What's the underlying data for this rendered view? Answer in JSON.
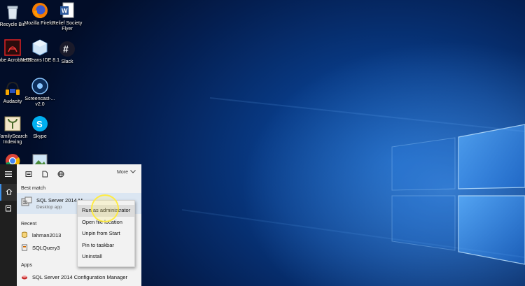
{
  "desktop_icons": [
    {
      "name": "recycle-bin-icon",
      "label": "Recycle Bin"
    },
    {
      "name": "firefox-icon",
      "label": "Mozilla Firefox"
    },
    {
      "name": "word-document-icon",
      "label": "Relief Society Flyer"
    },
    {
      "name": "acrobat-icon",
      "label": "Adobe Acrobat DC"
    },
    {
      "name": "netbeans-icon",
      "label": "NetBeans IDE 8.1"
    },
    {
      "name": "slack-icon",
      "label": "Slack"
    },
    {
      "name": "audacity-icon",
      "label": "Audacity"
    },
    {
      "name": "screencast-icon",
      "label": "Screencast-... v2.0"
    },
    {
      "name": "familysearch-icon",
      "label": "FamilySearch Indexing"
    },
    {
      "name": "skype-icon",
      "label": "Skype"
    },
    {
      "name": "chrome-icon",
      "label": ""
    },
    {
      "name": "picture-icon",
      "label": ""
    }
  ],
  "start_menu": {
    "more_label": "More",
    "best_match_header": "Best match",
    "best_match": {
      "title": "SQL Server 2014 M",
      "subtitle": "Desktop app"
    },
    "recent_header": "Recent",
    "recent_items": [
      "lahman2013",
      "SQLQuery3"
    ],
    "apps_header": "Apps",
    "apps_item": "SQL Server 2014 Configuration Manager"
  },
  "context_menu": {
    "items": [
      "Run as administrator",
      "Open file location",
      "Unpin from Start",
      "Pin to taskbar",
      "Uninstall"
    ]
  },
  "colors": {
    "accent": "#0b4fa8",
    "panel_bg": "#f2f2f2",
    "rail_bg": "#1f1f1f",
    "selected_row": "#dbe6f2",
    "highlight_ring": "#ffeb3c"
  }
}
